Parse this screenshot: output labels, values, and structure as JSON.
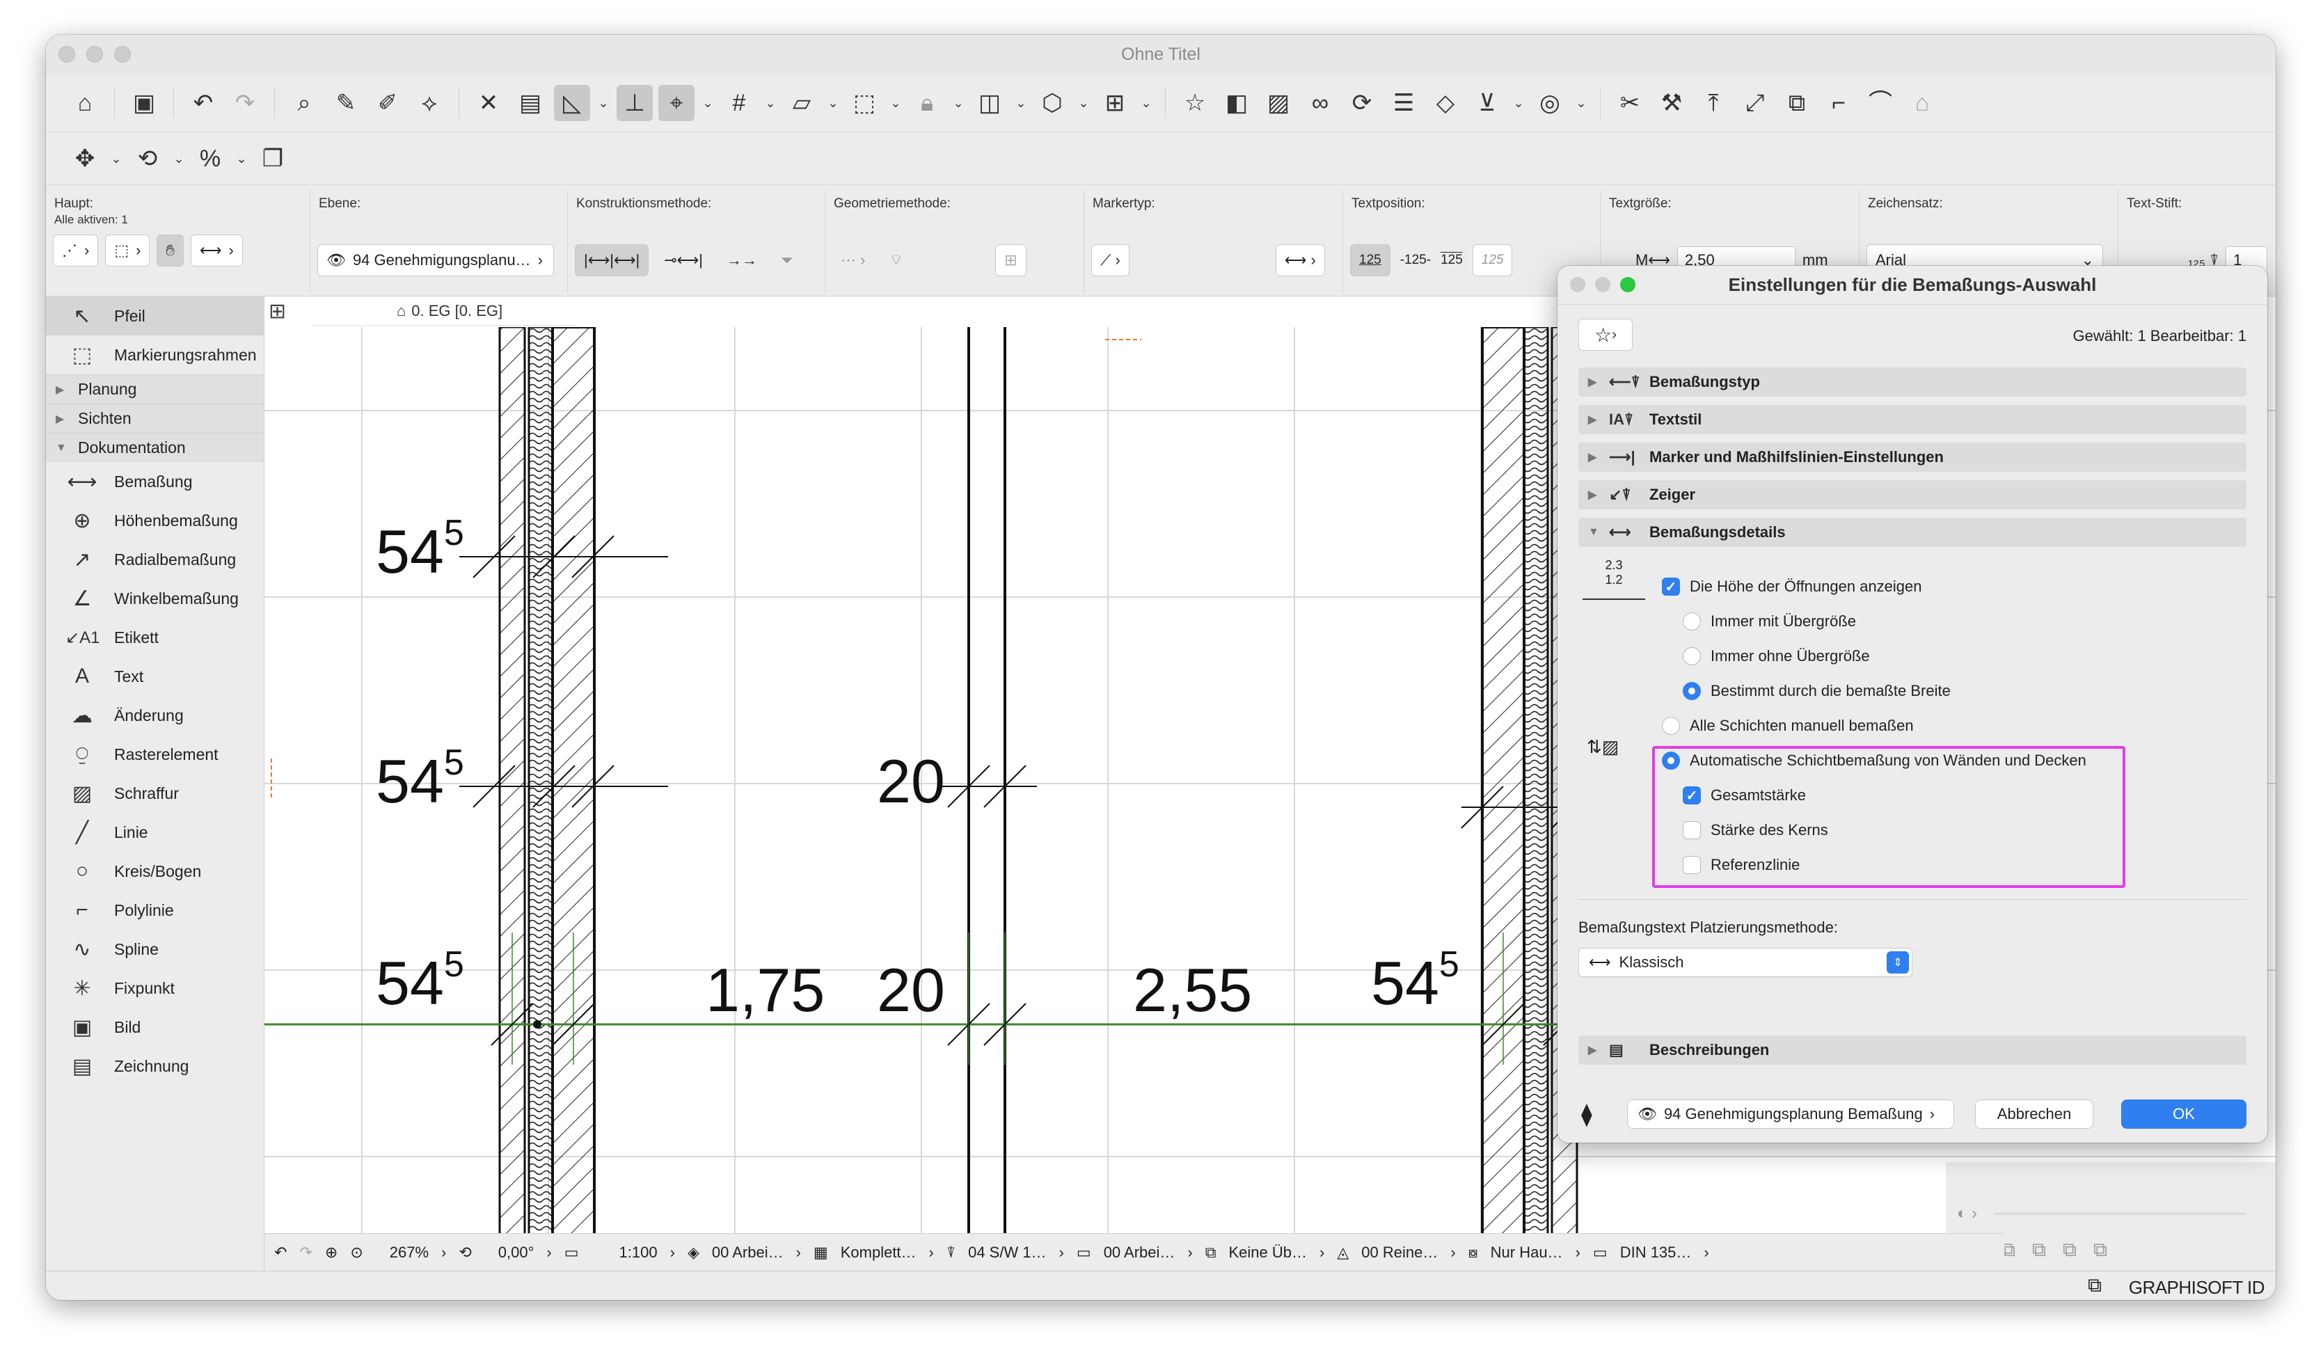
{
  "window": {
    "title": "Ohne Titel"
  },
  "infobox": {
    "haupt_label": "Haupt:",
    "alle_aktiven": "Alle aktiven: 1",
    "ebene_label": "Ebene:",
    "ebene_value": "94 Genehmigungsplanu…",
    "konstruktion_label": "Konstruktionsmethode:",
    "geometrie_label": "Geometriemethode:",
    "markertyp_label": "Markertyp:",
    "textposition_label": "Textposition:",
    "textpos_opts": [
      "125",
      "-125-",
      "125",
      "125"
    ],
    "textgroesse_label": "Textgröße:",
    "textgroesse_value": "2,50",
    "textgroesse_unit": "mm",
    "zeichensatz_label": "Zeichensatz:",
    "zeichensatz_value": "Arial",
    "textstift_label": "Text-Stift:",
    "textstift_value": "1"
  },
  "sidebar": {
    "top_items": [
      {
        "label": "Pfeil",
        "icon": "arrow-icon"
      },
      {
        "label": "Markierungsrahmen",
        "icon": "marquee-icon"
      }
    ],
    "groups": [
      "Planung",
      "Sichten",
      "Dokumentation"
    ],
    "doc_items": [
      {
        "label": "Bemaßung"
      },
      {
        "label": "Höhenbemaßung"
      },
      {
        "label": "Radialbemaßung"
      },
      {
        "label": "Winkelbemaßung"
      },
      {
        "label": "Etikett"
      },
      {
        "label": "Text"
      },
      {
        "label": "Änderung"
      },
      {
        "label": "Rasterelement"
      },
      {
        "label": "Schraffur"
      },
      {
        "label": "Linie"
      },
      {
        "label": "Kreis/Bogen"
      },
      {
        "label": "Polylinie"
      },
      {
        "label": "Spline"
      },
      {
        "label": "Fixpunkt"
      },
      {
        "label": "Bild"
      },
      {
        "label": "Zeichnung"
      }
    ]
  },
  "canvas": {
    "tab_label": "0. EG [0. EG]",
    "dims": {
      "d1": "54",
      "d1s": "5",
      "d2": "54",
      "d2s": "5",
      "d3": "54",
      "d3s": "5",
      "d4": "20",
      "d5": "1,75",
      "d6": "20",
      "d7": "2,55",
      "d8": "54",
      "d8s": "5"
    }
  },
  "statusbar": {
    "zoom": "267%",
    "angle": "0,00°",
    "scale": "1:100",
    "layers": "00 Arbei…",
    "model": "Komplett…",
    "pen": "04 S/W 1…",
    "view": "00 Arbei…",
    "override": "Keine Üb…",
    "reno": "00 Reine…",
    "struct": "Nur Hau…",
    "dim": "DIN 135…"
  },
  "brand": "GRAPHISOFT ID",
  "dialog": {
    "title": "Einstellungen für die Bemaßungs-Auswahl",
    "selected_info": "Gewählt: 1 Bearbeitbar: 1",
    "sections": [
      "Bemaßungstyp",
      "Textstil",
      "Marker und Maßhilfslinien-Einstellungen",
      "Zeiger",
      "Bemaßungsdetails"
    ],
    "show_height": "Die Höhe der Öffnungen anzeigen",
    "radio1": "Immer mit Übergröße",
    "radio2": "Immer ohne Übergröße",
    "radio3": "Bestimmt durch die bemaßte Breite",
    "radio4": "Alle Schichten manuell bemaßen",
    "radio5": "Automatische Schichtbemaßung von Wänden und Decken",
    "cb1": "Gesamtstärke",
    "cb2": "Stärke des Kerns",
    "cb3": "Referenzlinie",
    "placement_label": "Bemaßungstext Platzierungsmethode:",
    "placement_value": "Klassisch",
    "beschreibungen": "Beschreibungen",
    "layer_value": "94 Genehmigungsplanung Bemaßung",
    "cancel": "Abbrechen",
    "ok": "OK"
  },
  "colors": {
    "accent": "#2f7ff0",
    "highlight": "#e23ce8",
    "dimline": "#3a8a2a"
  }
}
